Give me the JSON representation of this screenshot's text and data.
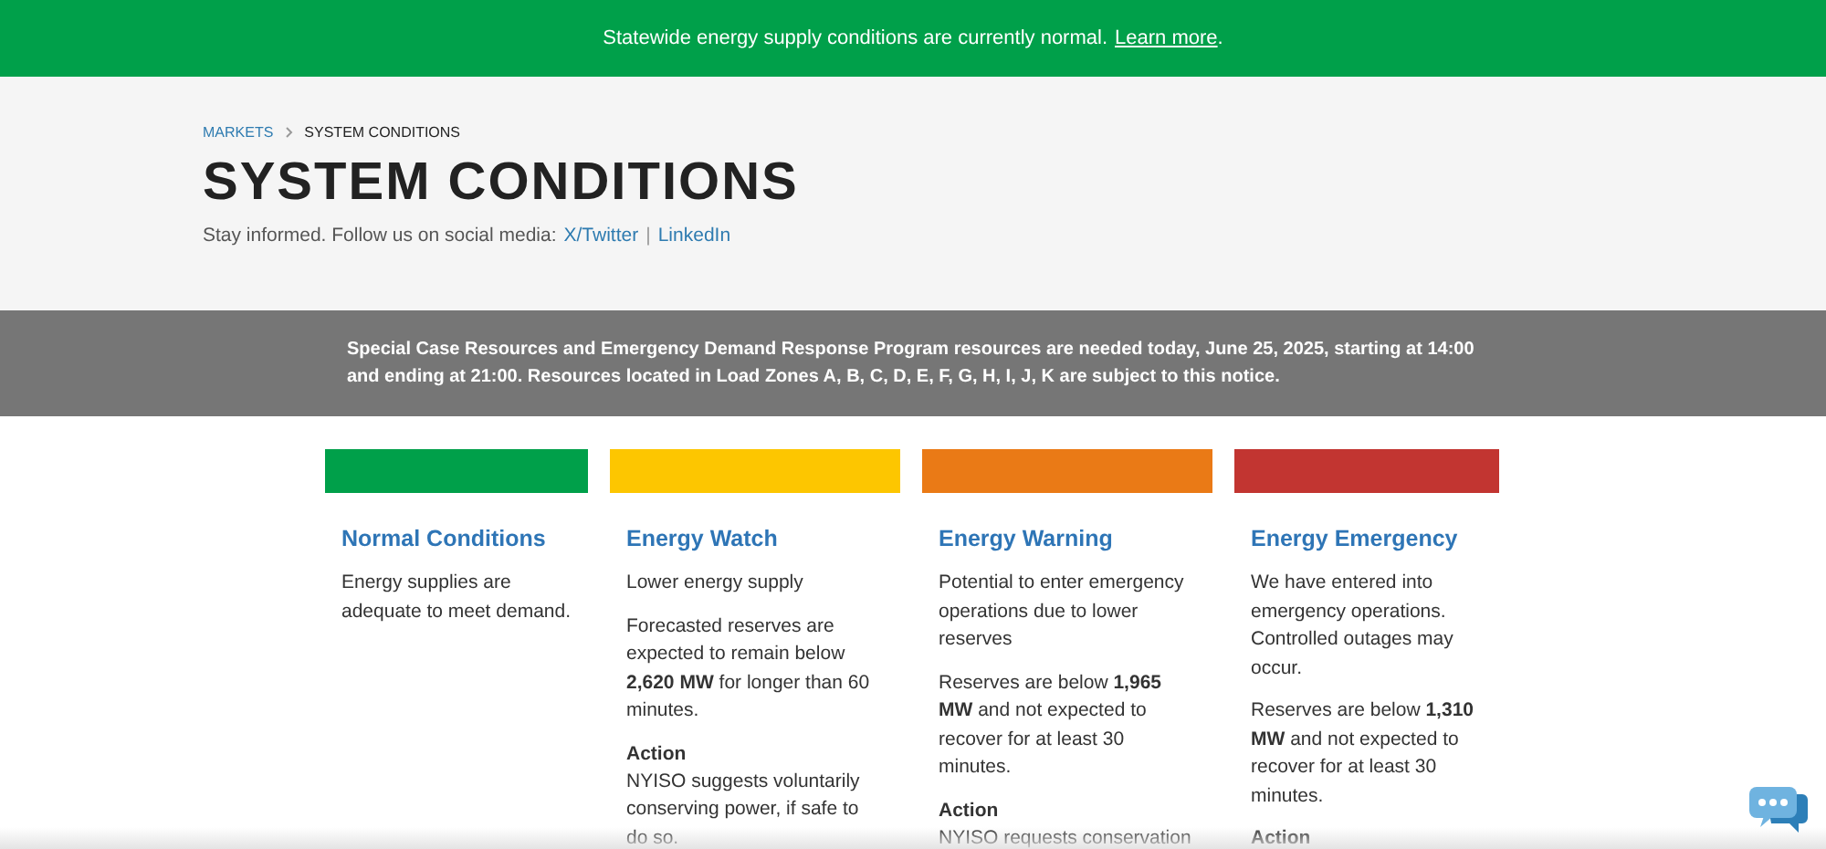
{
  "banner": {
    "text": "Statewide energy supply conditions are currently normal.",
    "link": "Learn more",
    "end": "."
  },
  "breadcrumb": [
    {
      "label": "MARKETS",
      "selected": false
    },
    {
      "label": "SYSTEM CONDITIONS",
      "selected": true
    }
  ],
  "title": "SYSTEM CONDITIONS",
  "social": {
    "text": "Stay informed. Follow us on social media:",
    "links": [
      "X/Twitter",
      "LinkedIn"
    ],
    "separator": "|"
  },
  "notice": "Special Case Resources and Emergency Demand Response Program resources are needed today, June 25, 2025, starting at 14:00 and ending at 21:00. Resources located in Load Zones A, B, C, D, E, F, G, H, I, J, K are subject to this notice.",
  "levels": [
    {
      "title": "Normal Conditions",
      "color": "#00a04a",
      "paragraphs": [
        "Energy supplies are adequate to meet demand."
      ]
    },
    {
      "title": "Energy Watch",
      "color": "#fdc600",
      "paragraphs": [
        "Lower energy supply",
        "Forecasted reserves are expected to remain below **2,620 MW** for longer than 60 minutes."
      ],
      "action": {
        "heading": "Action",
        "text": "NYISO suggests voluntarily conserving power, if safe to do so."
      }
    },
    {
      "title": "Energy Warning",
      "color": "#ea7a16",
      "paragraphs": [
        "Potential to enter emergency operations due to lower reserves",
        "Reserves are below **1,965 MW** and not expected to recover for at least 30 minutes."
      ],
      "action": {
        "heading": "Action",
        "text": "NYISO requests conservation"
      }
    },
    {
      "title": "Energy Emergency",
      "color": "#c23531",
      "paragraphs": [
        "We have entered into emergency operations. Controlled outages may occur.",
        "Reserves are below **1,310 MW** and not expected to recover for at least 30 minutes."
      ],
      "action": {
        "heading": "Action"
      }
    }
  ]
}
